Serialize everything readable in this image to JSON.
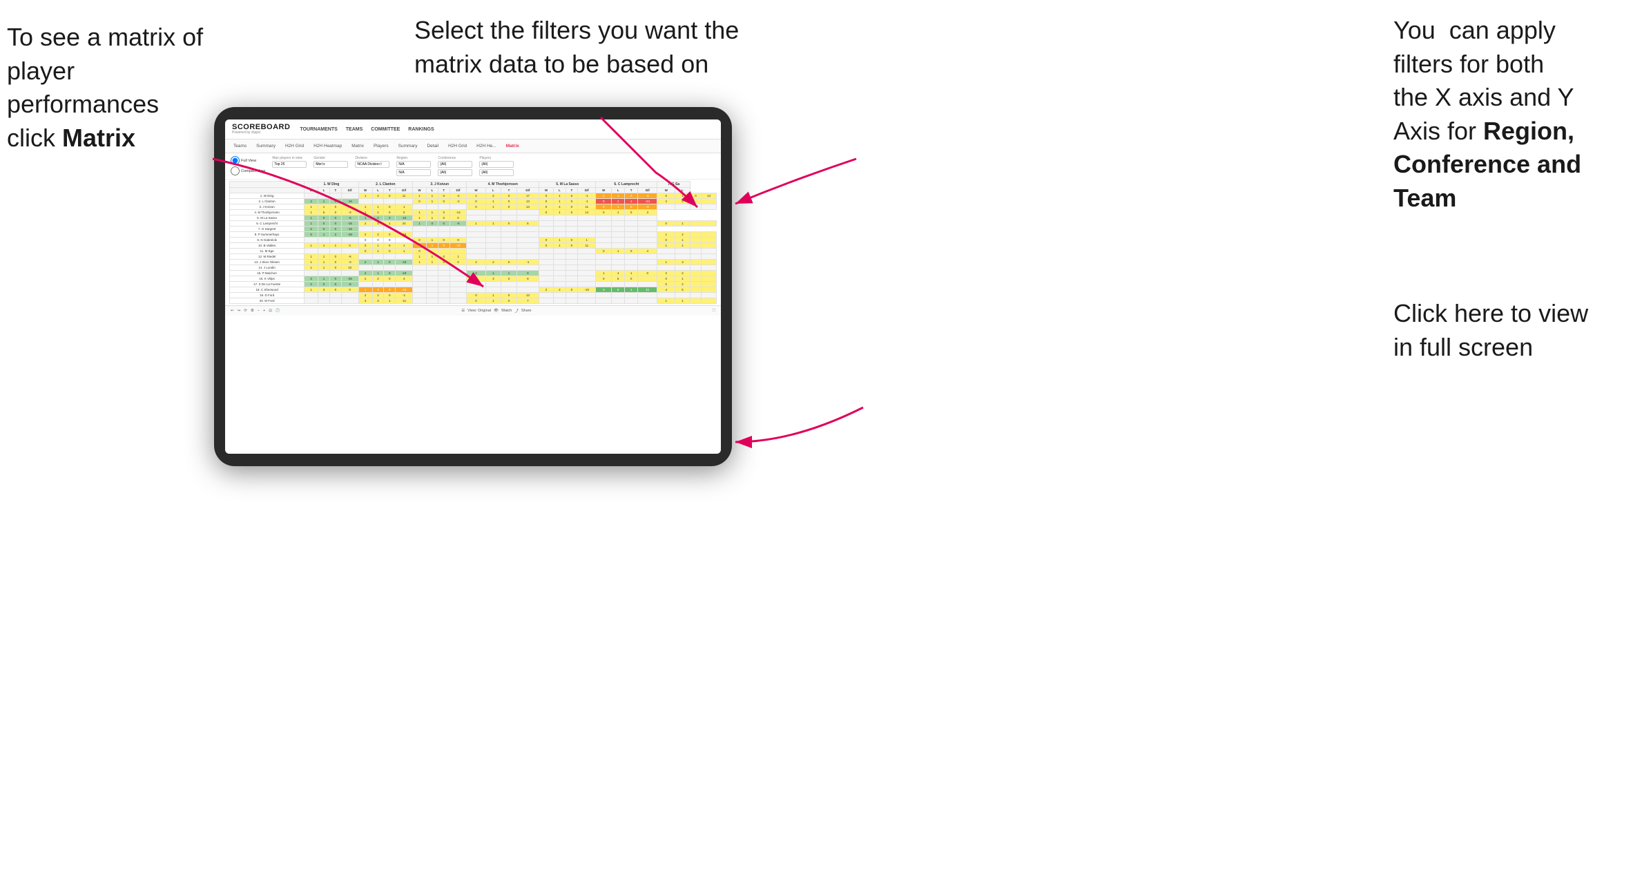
{
  "annotations": {
    "left": {
      "line1": "To see a matrix of",
      "line2": "player performances",
      "line3_pre": "click ",
      "line3_bold": "Matrix"
    },
    "center": {
      "text": "Select the filters you want the matrix data to be based on"
    },
    "right_top": {
      "line1": "You  can apply",
      "line2": "filters for both",
      "line3": "the X axis and Y",
      "line4_pre": "Axis for ",
      "line4_bold": "Region,",
      "line5_bold": "Conference and",
      "line6_bold": "Team"
    },
    "right_bottom": {
      "line1": "Click here to view",
      "line2": "in full screen"
    }
  },
  "app": {
    "brand_name": "SCOREBOARD",
    "brand_sub": "Powered by clippd",
    "nav": [
      "TOURNAMENTS",
      "TEAMS",
      "COMMITTEE",
      "RANKINGS"
    ],
    "sub_nav": [
      "Teams",
      "Summary",
      "H2H Grid",
      "H2H Heatmap",
      "Matrix",
      "Players",
      "Summary",
      "Detail",
      "H2H Grid",
      "H2H He...",
      "Matrix"
    ],
    "active_tab": "Matrix"
  },
  "filters": {
    "view_full": "Full View",
    "view_compact": "Compact View",
    "max_players_label": "Max players in view",
    "max_players_value": "Top 25",
    "gender_label": "Gender",
    "gender_value": "Men's",
    "division_label": "Division",
    "division_value": "NCAA Division I",
    "region_label": "Region",
    "region_value": "N/A",
    "region_value2": "N/A",
    "conference_label": "Conference",
    "conference_value": "(All)",
    "conference_value2": "(All)",
    "players_label": "Players",
    "players_value": "(All)",
    "players_value2": "(All)"
  },
  "matrix": {
    "col_headers": [
      "1. W Ding",
      "2. L Clanton",
      "3. J Koivun",
      "4. M Thorbjornsen",
      "5. M La Sasso",
      "6. C Lamprecht",
      "7. G Sa"
    ],
    "sub_headers": [
      "W",
      "L",
      "T",
      "Dif"
    ],
    "rows": [
      {
        "name": "1. W Ding",
        "cells": [
          "g2",
          "g1",
          "w",
          "r",
          "g1",
          "g2",
          "y",
          "g2",
          "g1",
          "y",
          "y",
          "g1",
          "g2",
          "g2",
          "y",
          "g2",
          "g1",
          "g2",
          "w",
          "g2",
          "g2",
          "y",
          "g2",
          "g1",
          "g1",
          "g2",
          "g2",
          "y"
        ]
      },
      {
        "name": "2. L Clanton",
        "cells": [
          "r",
          "y",
          "g1",
          "g2",
          "y",
          "g1",
          "g2",
          "y",
          "g2",
          "g1",
          "g2",
          "r",
          "y",
          "g2",
          "g1",
          "y",
          "g2",
          "g2",
          "w",
          "g2",
          "g1",
          "g2",
          "y",
          "g1",
          "g2",
          "g1",
          "y",
          "g2"
        ]
      },
      {
        "name": "3. J Koivun",
        "cells": [
          "y",
          "g1",
          "g2",
          "y",
          "g1",
          "g2",
          "g2",
          "g1",
          "y",
          "g2",
          "g1",
          "g2",
          "y",
          "g1",
          "g2",
          "y",
          "g1",
          "g2",
          "g2",
          "g1",
          "y",
          "g2",
          "g1",
          "g2",
          "y",
          "g1",
          "g2",
          "y"
        ]
      },
      {
        "name": "4. M Thorbjornsen",
        "cells": [
          "g2",
          "y",
          "g1",
          "g2",
          "y",
          "g1",
          "g2",
          "y",
          "g1",
          "g2",
          "y",
          "g1",
          "g2",
          "y",
          "g1",
          "g2",
          "y",
          "g2",
          "g1",
          "y",
          "g2",
          "g1",
          "y",
          "g2",
          "g1",
          "y",
          "g2",
          "g1"
        ]
      },
      {
        "name": "5. M La Sasso",
        "cells": [
          "y",
          "g2",
          "g1",
          "y",
          "g2",
          "g1",
          "y",
          "g2",
          "g1",
          "y",
          "g2",
          "g1",
          "y",
          "g2",
          "g1",
          "y",
          "g1",
          "g2",
          "y",
          "g2",
          "g1",
          "y",
          "g2",
          "g1",
          "y",
          "g2",
          "g1",
          "y"
        ]
      },
      {
        "name": "6. C Lamprecht",
        "cells": [
          "g1",
          "y",
          "g2",
          "g1",
          "y",
          "g2",
          "g1",
          "y",
          "g2",
          "g1",
          "y",
          "g2",
          "g1",
          "y",
          "g2",
          "g1",
          "y",
          "g1",
          "g2",
          "y",
          "g2",
          "g1",
          "y",
          "g2",
          "g1",
          "y",
          "g2",
          "g1"
        ]
      },
      {
        "name": "7. G Sargent",
        "cells": [
          "g2",
          "g1",
          "y",
          "g2",
          "g1",
          "y",
          "g2",
          "g1",
          "y",
          "g2",
          "g1",
          "y",
          "g2",
          "g1",
          "y",
          "g2",
          "g1",
          "y",
          "g1",
          "g2",
          "y",
          "g1",
          "g2",
          "y",
          "g1",
          "g2",
          "y",
          "g1"
        ]
      },
      {
        "name": "8. P Summerhays",
        "cells": [
          "y",
          "g2",
          "g1",
          "y",
          "g2",
          "g1",
          "y",
          "g2",
          "g1",
          "y",
          "g2",
          "g1",
          "y",
          "g2",
          "g1",
          "y",
          "g2",
          "y",
          "g1",
          "g2",
          "y",
          "g2",
          "g1",
          "y",
          "g2",
          "g1",
          "y",
          "g2"
        ]
      },
      {
        "name": "9. N Gabrelcik",
        "cells": [
          "g1",
          "y",
          "g2",
          "g1",
          "y",
          "g2",
          "g1",
          "y",
          "g2",
          "g1",
          "y",
          "g2",
          "g1",
          "y",
          "g2",
          "g1",
          "y",
          "g1",
          "y",
          "g2",
          "g1",
          "y",
          "g2",
          "g1",
          "y",
          "g2",
          "g1",
          "y"
        ]
      },
      {
        "name": "10. B Valdes",
        "cells": [
          "g2",
          "g1",
          "y",
          "g2",
          "g1",
          "y",
          "g2",
          "g1",
          "y",
          "g2",
          "g1",
          "y",
          "g2",
          "g1",
          "y",
          "g2",
          "g1",
          "y",
          "g2",
          "g1",
          "y",
          "g2",
          "g1",
          "y",
          "g2",
          "g1",
          "y",
          "g2"
        ]
      },
      {
        "name": "11. M Ege",
        "cells": [
          "y",
          "g2",
          "g1",
          "y",
          "g2",
          "g1",
          "y",
          "g2",
          "g1",
          "y",
          "g2",
          "g1",
          "y",
          "g2",
          "g1",
          "y",
          "g2",
          "g1",
          "y",
          "g2",
          "g1",
          "y",
          "g2",
          "g1",
          "y",
          "g2",
          "g1",
          "y"
        ]
      },
      {
        "name": "12. M Riedel",
        "cells": [
          "g1",
          "y",
          "g2",
          "g1",
          "y",
          "g2",
          "g1",
          "y",
          "g2",
          "g1",
          "y",
          "g2",
          "g1",
          "y",
          "g2",
          "g1",
          "y",
          "g2",
          "g1",
          "y",
          "g2",
          "g1",
          "y",
          "g2",
          "g1",
          "y",
          "g2",
          "g1"
        ]
      },
      {
        "name": "13. J Skov Olesen",
        "cells": [
          "g2",
          "g1",
          "y",
          "g2",
          "g1",
          "y",
          "g2",
          "g1",
          "y",
          "g2",
          "g1",
          "y",
          "g2",
          "g1",
          "y",
          "g2",
          "g1",
          "y",
          "g2",
          "g1",
          "y",
          "g2",
          "g1",
          "y",
          "g2",
          "g1",
          "y",
          "g2"
        ]
      },
      {
        "name": "14. J Lundin",
        "cells": [
          "y",
          "g2",
          "g1",
          "y",
          "g2",
          "g1",
          "y",
          "g2",
          "g1",
          "y",
          "g2",
          "g1",
          "y",
          "g2",
          "g1",
          "y",
          "g2",
          "g1",
          "y",
          "g2",
          "g1",
          "y",
          "g2",
          "g1",
          "y",
          "g2",
          "g1",
          "y"
        ]
      },
      {
        "name": "15. P Maichon",
        "cells": [
          "g1",
          "y",
          "g2",
          "g1",
          "y",
          "g2",
          "g1",
          "y",
          "g2",
          "g1",
          "y",
          "g2",
          "g1",
          "y",
          "g2",
          "g1",
          "y",
          "g2",
          "g1",
          "y",
          "g2",
          "g1",
          "y",
          "g2",
          "g1",
          "y",
          "g2",
          "g1"
        ]
      },
      {
        "name": "16. K Vilips",
        "cells": [
          "g2",
          "g1",
          "y",
          "g2",
          "g1",
          "y",
          "g2",
          "g1",
          "y",
          "g2",
          "g1",
          "y",
          "g2",
          "g1",
          "y",
          "g2",
          "g1",
          "y",
          "g2",
          "g1",
          "y",
          "g2",
          "g1",
          "y",
          "g2",
          "g1",
          "y",
          "g2"
        ]
      },
      {
        "name": "17. S De La Fuente",
        "cells": [
          "y",
          "g2",
          "g1",
          "y",
          "g2",
          "g1",
          "y",
          "g2",
          "g1",
          "y",
          "g2",
          "g1",
          "y",
          "g2",
          "g1",
          "y",
          "g2",
          "g1",
          "y",
          "g2",
          "g1",
          "y",
          "g2",
          "g1",
          "y",
          "g2",
          "g1",
          "y"
        ]
      },
      {
        "name": "18. C Sherwood",
        "cells": [
          "g1",
          "y",
          "g2",
          "g1",
          "y",
          "g2",
          "g1",
          "y",
          "g2",
          "g1",
          "y",
          "g2",
          "g1",
          "y",
          "g2",
          "g1",
          "y",
          "g2",
          "g1",
          "y",
          "g2",
          "g1",
          "y",
          "g2",
          "g1",
          "y",
          "g2",
          "g1"
        ]
      },
      {
        "name": "19. D Ford",
        "cells": [
          "g2",
          "g1",
          "y",
          "g2",
          "g1",
          "y",
          "g2",
          "g1",
          "y",
          "g2",
          "g1",
          "y",
          "g2",
          "g1",
          "y",
          "g2",
          "g1",
          "y",
          "g2",
          "g1",
          "y",
          "g2",
          "g1",
          "y",
          "g2",
          "g1",
          "y",
          "g2"
        ]
      },
      {
        "name": "20. M Ford",
        "cells": [
          "y",
          "g2",
          "g1",
          "y",
          "g2",
          "g1",
          "y",
          "g2",
          "g1",
          "y",
          "g2",
          "g1",
          "y",
          "g2",
          "g1",
          "y",
          "g2",
          "g1",
          "y",
          "g2",
          "g1",
          "y",
          "g2",
          "g1",
          "y",
          "g2",
          "g1",
          "y"
        ]
      }
    ]
  },
  "toolbar": {
    "view_label": "View: Original",
    "watch_label": "Watch",
    "share_label": "Share"
  }
}
